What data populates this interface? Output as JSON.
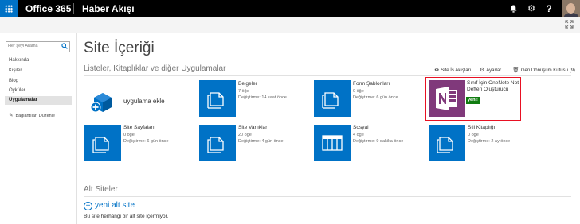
{
  "topbar": {
    "suite_title": "Office 365",
    "site_link": "Haber Akışı",
    "bell_icon": "bell-icon",
    "gear_icon": "gear-icon",
    "help_label": "?"
  },
  "leftnav": {
    "search_placeholder": "Her şeyi Arama",
    "items": [
      "Hakkında",
      "Kişiler",
      "Blog",
      "Öyküler",
      "Uygulamalar"
    ],
    "edit_links": "Bağlantıları Düzenle"
  },
  "main": {
    "page_title": "Site İçeriği",
    "section_title": "Listeler, Kitaplıklar ve diğer Uygulamalar",
    "tools": {
      "workflows": "Site İş Akışları",
      "settings": "Ayarlar",
      "recycle": "Geri Dönüşüm Kutusu (9)"
    },
    "add_app": "uygulama ekle",
    "tiles": [
      {
        "name": "Belgeler",
        "count": "7 öğe",
        "modified": "Değiştirme: 14 saat önce"
      },
      {
        "name": "Form Şablonları",
        "count": "0 öğe",
        "modified": "Değiştirme: 6 gün önce"
      },
      {
        "name": "Sınıf İçin OneNote Not Defteri Oluşturucu",
        "badge": "yeni!"
      },
      {
        "name": "Site Sayfaları",
        "count": "0 öğe",
        "modified": "Değiştirme: 6 gün önce"
      },
      {
        "name": "Site Varlıkları",
        "count": "20 öğe",
        "modified": "Değiştirme: 4 gün önce"
      },
      {
        "name": "Sosyal",
        "count": "4 öğe",
        "modified": "Değiştirme: 9 dakika önce"
      },
      {
        "name": "Stil Kitaplığı",
        "count": "0 öğe",
        "modified": "Değiştirme: 2 ay önce"
      }
    ],
    "subsites_title": "Alt Siteler",
    "new_subsite": "yeni alt site",
    "no_subsites": "Bu site herhangi bir alt site içermiyor.",
    "colors": {
      "accent": "#0072c6",
      "onenote": "#80397b",
      "new_badge": "#107c10",
      "highlight": "#e81123"
    }
  }
}
